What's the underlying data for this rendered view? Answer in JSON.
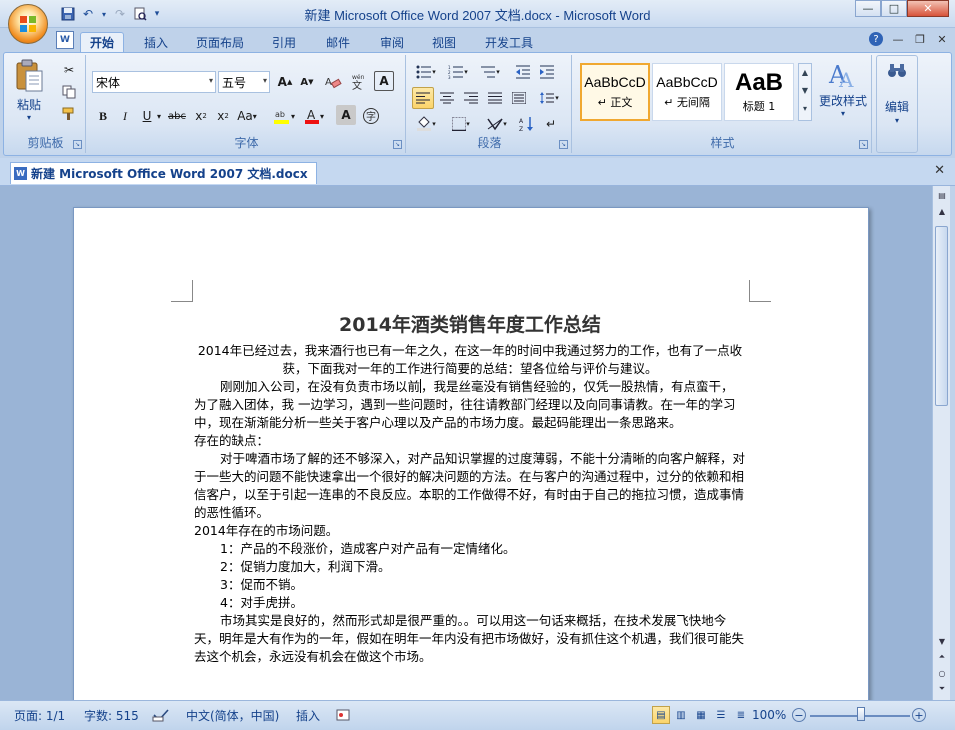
{
  "window": {
    "title": "新建 Microsoft Office Word 2007 文档.docx - Microsoft Word",
    "min": "—",
    "max": "□",
    "close": "✕"
  },
  "tabs": [
    {
      "label": "开始"
    },
    {
      "label": "插入"
    },
    {
      "label": "页面布局"
    },
    {
      "label": "引用"
    },
    {
      "label": "邮件"
    },
    {
      "label": "审阅"
    },
    {
      "label": "视图"
    },
    {
      "label": "开发工具"
    }
  ],
  "ribbon": {
    "clipboard": {
      "label": "剪贴板",
      "paste": "粘贴"
    },
    "font": {
      "label": "字体",
      "name": "宋体",
      "size": "五号"
    },
    "paragraph": {
      "label": "段落"
    },
    "styles": {
      "label": "样式",
      "cards": [
        {
          "sample": "AaBbCcD",
          "name": "↵ 正文"
        },
        {
          "sample": "AaBbCcD",
          "name": "↵ 无间隔"
        },
        {
          "sample": "AaB",
          "name": "标题 1"
        }
      ],
      "change": "更改样式"
    },
    "editing": {
      "label": "编辑"
    }
  },
  "doc_tab": {
    "label": "新建 Microsoft Office Word 2007 文档.docx"
  },
  "document": {
    "title": "2014年酒类销售年度工作总结",
    "p1": "2014年已经过去，我来酒行也已有一年之久，在这一年的时间中我通过努力的工作，也有了一点收获，下面我对一年的工作进行简要的总结：望各位给与评价与建议。",
    "p2a": "刚刚加入公司，在没有负责市场以前",
    "p2b": "，我是丝毫没有销售经验的，仅凭一股热情，有点蛮干，为了融入团体，我 一边学习，遇到一些问题时，往往请教部门经理以及向同事请教。在一年的学习中，现在渐渐能分析一些关于客户心理以及产品的市场力度。最起码能理出一条思路来。",
    "h1": "存在的缺点：",
    "p3": "对于啤酒市场了解的还不够深入，对产品知识掌握的过度薄弱，不能十分清晰的向客户解释，对于一些大的问题不能快速拿出一个很好的解决问题的方法。在与客户的沟通过程中，过分的依赖和相信客户，以至于引起一连串的不良反应。本职的工作做得不好，有时由于自己的拖拉习惯，造成事情的恶性循环。",
    "h2": "2014年存在的市场问题。",
    "items": [
      "1：产品的不段涨价，造成客户对产品有一定情绪化。",
      "2：促销力度加大，利润下滑。",
      "3：促而不销。",
      "4：对手虎拼。"
    ],
    "p4": "市场其实是良好的，然而形式却是很严重的。。可以用这一句话来概括，在技术发展飞快地今天，明年是大有作为的一年，假如在明年一年内没有把市场做好，没有抓住这个机遇，我们很可能失去这个机会，永远没有机会在做这个市场。"
  },
  "status": {
    "page": "页面: 1/1",
    "words": "字数: 515",
    "language": "中文(简体，中国)",
    "mode": "插入",
    "zoom": "100%",
    "zoom_level_percent": 100
  }
}
